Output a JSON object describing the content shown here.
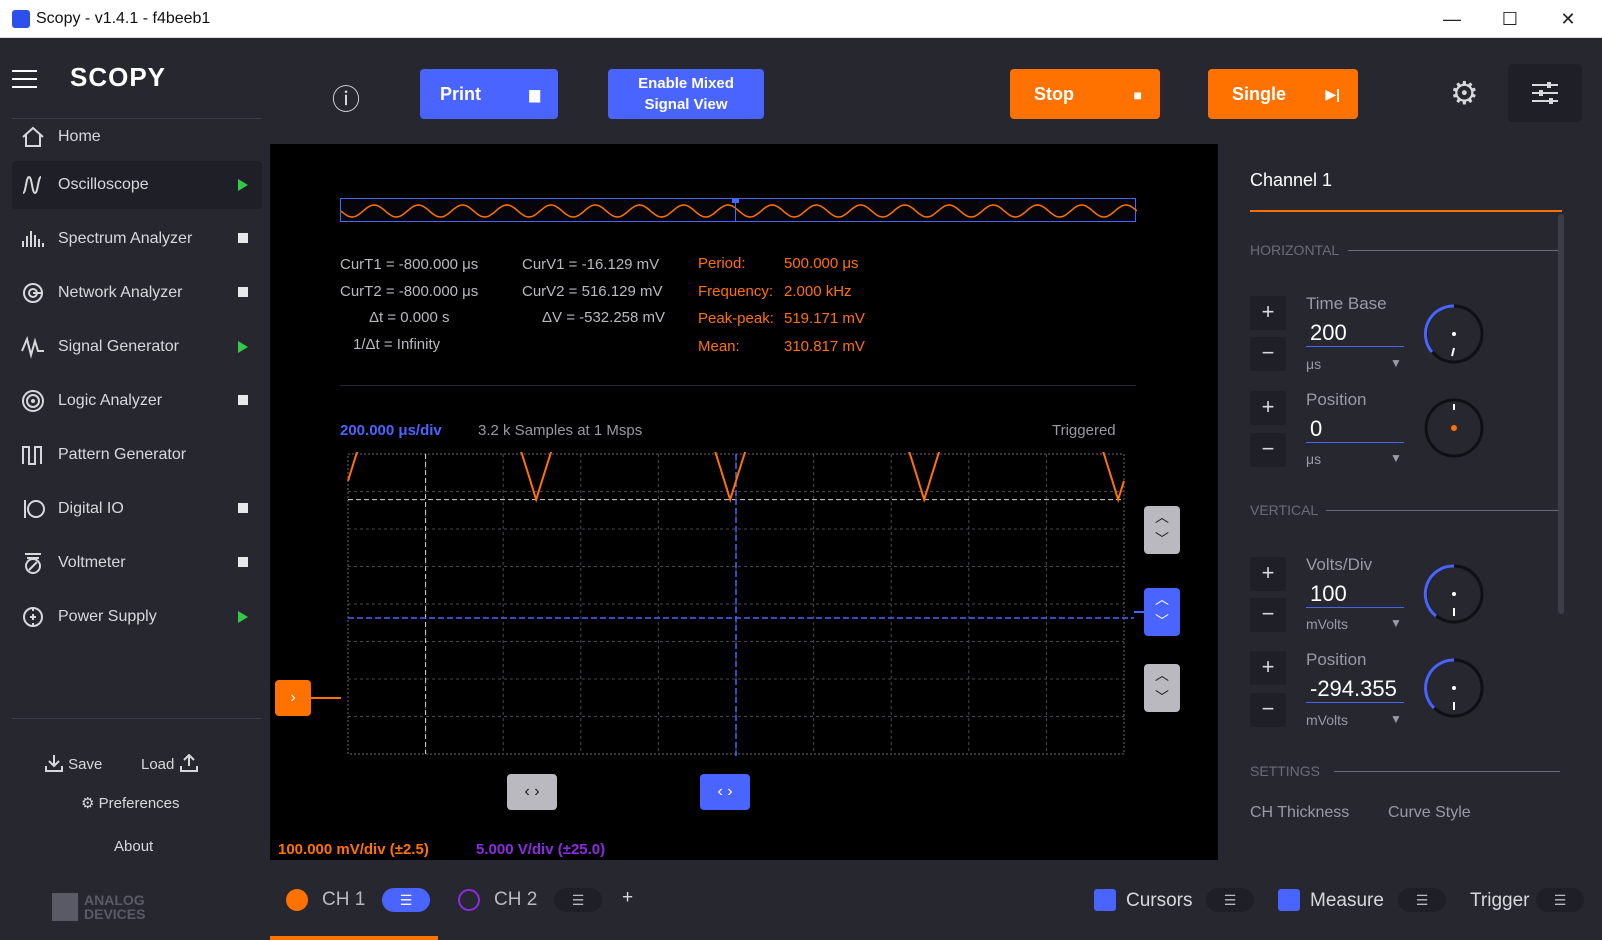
{
  "window": {
    "title": "Scopy - v1.4.1 - f4beeb1",
    "minimize": "—",
    "maximize": "☐",
    "close": "✕"
  },
  "sidebar": {
    "logo": "SCOPY",
    "home": "Home",
    "items": [
      {
        "label": "Oscilloscope",
        "state": "running"
      },
      {
        "label": "Spectrum Analyzer",
        "state": "stopped"
      },
      {
        "label": "Network Analyzer",
        "state": "stopped"
      },
      {
        "label": "Signal Generator",
        "state": "running"
      },
      {
        "label": "Logic Analyzer",
        "state": "stopped"
      },
      {
        "label": "Pattern Generator",
        "state": "none"
      },
      {
        "label": "Digital IO",
        "state": "stopped"
      },
      {
        "label": "Voltmeter",
        "state": "stopped"
      },
      {
        "label": "Power Supply",
        "state": "running"
      }
    ],
    "save": "Save",
    "load": "Load",
    "preferences": "Preferences",
    "about": "About",
    "vendor": "ANALOG DEVICES"
  },
  "toolbar": {
    "info_icon": "ⓘ",
    "print": "Print",
    "enable_mixed_line1": "Enable Mixed",
    "enable_mixed_line2": "Signal View",
    "stop": "Stop",
    "single": "Single"
  },
  "measurements": {
    "curt1_label": "CurT1 =",
    "curt1": "-800.000 μs",
    "curt2_label": "CurT2 =",
    "curt2": "-800.000 μs",
    "dt_label": "Δt =",
    "dt": "0.000 s",
    "inv_dt_label": "1/Δt =",
    "inv_dt": "Infinity",
    "curv1_label": "CurV1 =",
    "curv1": "-16.129 mV",
    "curv2_label": "CurV2 =",
    "curv2": "516.129 mV",
    "dv_label": "ΔV =",
    "dv": "-532.258 mV",
    "period_label": "Period:",
    "period": "500.000 μs",
    "frequency_label": "Frequency:",
    "frequency": "2.000 kHz",
    "peakpeak_label": "Peak-peak:",
    "peakpeak": "519.171 mV",
    "mean_label": "Mean:",
    "mean": "310.817 mV"
  },
  "plot": {
    "timebase": "200.000 μs/div",
    "samples": "3.2 k Samples at 1 Msps",
    "status": "Triggered",
    "ch1_scale": "100.000 mV/div (±2.5)",
    "ch2_scale": "5.000 V/div (±25.0)"
  },
  "chart_data": {
    "type": "line",
    "title": "",
    "xlabel": "",
    "ylabel": "",
    "waveform": "full-wave rectified sine",
    "period_us": 500,
    "timebase_us_per_div": 200,
    "x_divisions": 10,
    "y_divisions": 8,
    "series": [
      {
        "name": "CH 1",
        "color": "#ff7200",
        "peak_mV": 516,
        "trough_mV": -16
      }
    ]
  },
  "right_panel": {
    "title": "Channel 1",
    "horizontal": "HORIZONTAL",
    "time_base_label": "Time Base",
    "time_base_value": "200",
    "time_base_unit": "μs",
    "h_position_label": "Position",
    "h_position_value": "0",
    "h_position_unit": "μs",
    "vertical": "VERTICAL",
    "volts_div_label": "Volts/Div",
    "volts_div_value": "100",
    "volts_div_unit": "mVolts",
    "v_position_label": "Position",
    "v_position_value": "-294.355",
    "v_position_unit": "mVolts",
    "settings": "SETTINGS",
    "ch_thickness": "CH Thickness",
    "curve_style": "Curve Style"
  },
  "bottom": {
    "ch1": "CH 1",
    "ch2": "CH 2",
    "add": "+",
    "cursors": "Cursors",
    "measure": "Measure",
    "trigger": "Trigger"
  },
  "colors": {
    "accent_blue": "#4a64ff",
    "accent_orange": "#ff7200",
    "ch2_purple": "#8b2be2",
    "running_green": "#35c94b"
  }
}
